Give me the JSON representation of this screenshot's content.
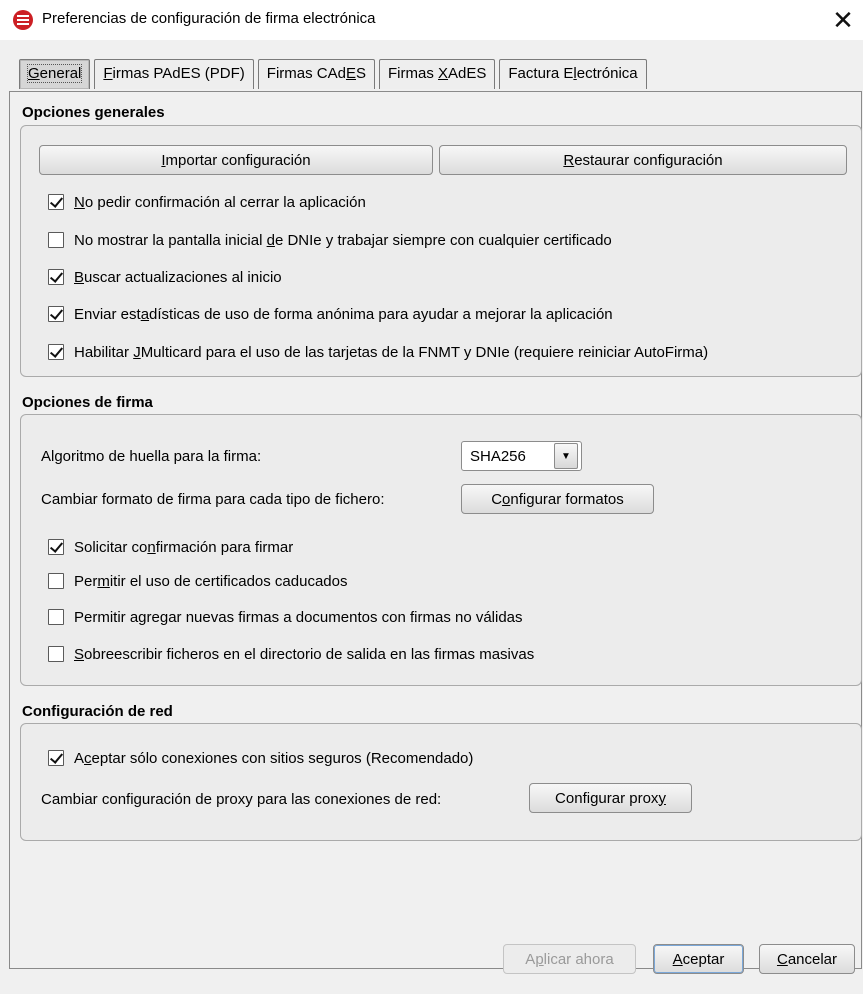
{
  "window": {
    "title": "Preferencias de configuración de firma electrónica",
    "close_glyph": "✕"
  },
  "tabs": [
    {
      "label_pre": "",
      "mnemonic": "G",
      "label_post": "eneral",
      "active": true
    },
    {
      "label_pre": "",
      "mnemonic": "F",
      "label_post": "irmas PAdES (PDF)",
      "active": false
    },
    {
      "label_pre": "Firmas CAd",
      "mnemonic": "E",
      "label_post": "S",
      "active": false
    },
    {
      "label_pre": "Firmas ",
      "mnemonic": "X",
      "label_post": "AdES",
      "active": false
    },
    {
      "label_pre": "Factura E",
      "mnemonic": "l",
      "label_post": "ectrónica",
      "active": false
    }
  ],
  "general": {
    "title": "Opciones generales",
    "import_button": {
      "pre": "",
      "mn": "I",
      "post": "mportar configuración"
    },
    "restore_button": {
      "pre": "",
      "mn": "R",
      "post": "estaurar configuración"
    },
    "checks": [
      {
        "pre": "",
        "mn": "N",
        "post": "o pedir confirmación al cerrar la aplicación",
        "checked": true
      },
      {
        "pre": "No mostrar la pantalla inicial ",
        "mn": "d",
        "post": "e DNIe y trabajar siempre con cualquier certificado",
        "checked": false
      },
      {
        "pre": "",
        "mn": "B",
        "post": "uscar actualizaciones al inicio",
        "checked": true
      },
      {
        "pre": "Enviar est",
        "mn": "a",
        "post": "dísticas de uso de forma anónima para ayudar a mejorar la aplicación",
        "checked": true
      },
      {
        "pre": "Habilitar ",
        "mn": "J",
        "post": "Multicard para el uso de las tarjetas de la FNMT y DNIe (requiere reiniciar AutoFirma)",
        "checked": true
      }
    ]
  },
  "firma": {
    "title": "Opciones de firma",
    "hash_label": "Algoritmo de huella para la firma:",
    "hash_value": "SHA256",
    "format_label": "Cambiar formato de firma para cada tipo de fichero:",
    "format_button": {
      "pre": "C",
      "mn": "o",
      "post": "nfigurar formatos"
    },
    "checks": [
      {
        "pre": "Solicitar co",
        "mn": "n",
        "post": "firmación para firmar",
        "checked": true
      },
      {
        "pre": "Per",
        "mn": "m",
        "post": "itir el uso de certificados caducados",
        "checked": false
      },
      {
        "pre": "Permitir agregar nuevas firmas a documentos con firmas no válidas",
        "mn": "",
        "post": "",
        "checked": false
      },
      {
        "pre": "",
        "mn": "S",
        "post": "obreescribir ficheros en el directorio de salida en las firmas masivas",
        "checked": false
      }
    ]
  },
  "red": {
    "title": "Configuración de red",
    "check": {
      "pre": "A",
      "mn": "c",
      "post": "eptar sólo conexiones con sitios seguros (Recomendado)",
      "checked": true
    },
    "proxy_label": "Cambiar configuración de proxy para las conexiones de red:",
    "proxy_button": {
      "pre": "Configurar prox",
      "mn": "y",
      "post": ""
    }
  },
  "footer": {
    "apply_button": {
      "pre": "A",
      "mn": "p",
      "post": "licar ahora"
    },
    "accept_button": {
      "pre": "",
      "mn": "A",
      "post": "ceptar"
    },
    "cancel_button": {
      "pre": "",
      "mn": "C",
      "post": "ancelar"
    }
  }
}
